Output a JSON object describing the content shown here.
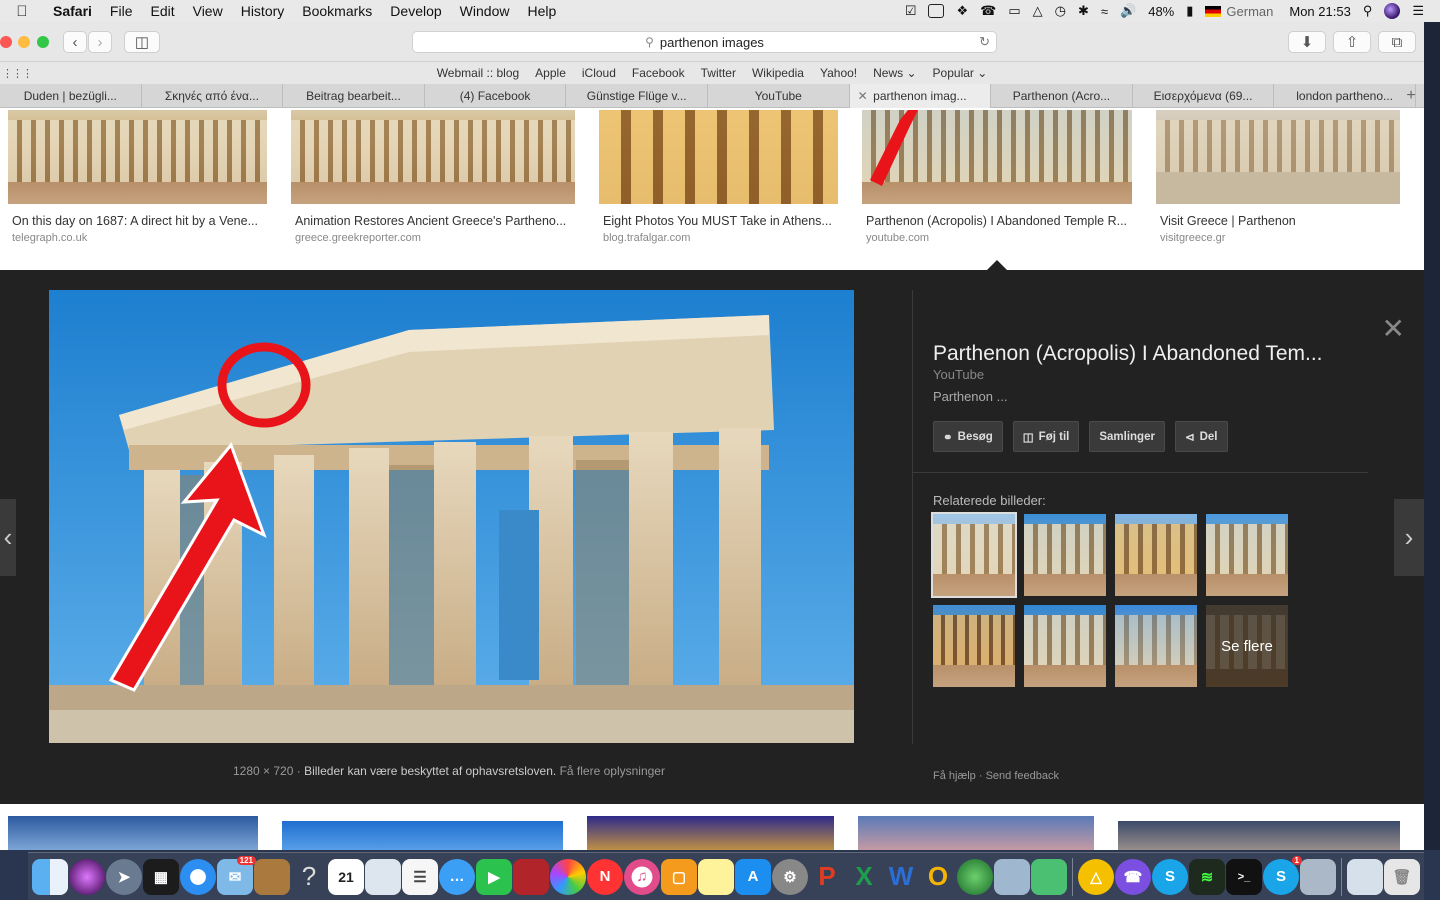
{
  "menubar": {
    "app": "Safari",
    "items": [
      "File",
      "Edit",
      "View",
      "History",
      "Bookmarks",
      "Develop",
      "Window",
      "Help"
    ],
    "battery": "48%",
    "language": "German",
    "clock": "Mon 21:53"
  },
  "browser": {
    "address": "parthenon  images",
    "favorites": [
      "Webmail :: blog",
      "Apple",
      "iCloud",
      "Facebook",
      "Twitter",
      "Wikipedia",
      "Yahoo!",
      "News ⌄",
      "Popular ⌄"
    ],
    "tabs": [
      {
        "label": "Duden | bezügli..."
      },
      {
        "label": "Σκηνές από ένα..."
      },
      {
        "label": "Beitrag bearbeit..."
      },
      {
        "label": "(4) Facebook"
      },
      {
        "label": "Günstige Flüge v..."
      },
      {
        "label": "YouTube"
      },
      {
        "label": "parthenon imag..."
      },
      {
        "label": "Parthenon (Acro..."
      },
      {
        "label": "Εισερχόμενα (69..."
      },
      {
        "label": "london partheno..."
      }
    ]
  },
  "results": [
    {
      "title": "On this day on 1687: A direct hit by a Vene...",
      "source": "telegraph.co.uk"
    },
    {
      "title": "Animation Restores Ancient Greece's Partheno...",
      "source": "greece.greekreporter.com"
    },
    {
      "title": "Eight Photos You MUST Take in Athens...",
      "source": "blog.trafalgar.com"
    },
    {
      "title": "Parthenon (Acropolis) I Abandoned Temple R...",
      "source": "youtube.com"
    },
    {
      "title": "Visit Greece | Parthenon",
      "source": "visitgreece.gr"
    }
  ],
  "preview": {
    "title": "Parthenon (Acropolis) I Abandoned Tem...",
    "site": "YouTube",
    "description": "Parthenon ...",
    "actions": {
      "visit": "Besøg",
      "save": "Føj til",
      "collections": "Samlinger",
      "share": "Del"
    },
    "related_label": "Relaterede billeder:",
    "see_more": "Se flere",
    "dimensions": "1280 × 720",
    "copyright": "Billeder kan være beskyttet af ophavsretsloven.",
    "more_info": "Få flere oplysninger",
    "help": "Få hjælp",
    "feedback": "Send feedback",
    "dot": "·"
  },
  "dock": {
    "badges": {
      "mail": "121",
      "skype": "1"
    },
    "calendar_day": "21"
  },
  "colors": {
    "panel_bg": "#222222",
    "annotation_red": "#e8141a"
  }
}
